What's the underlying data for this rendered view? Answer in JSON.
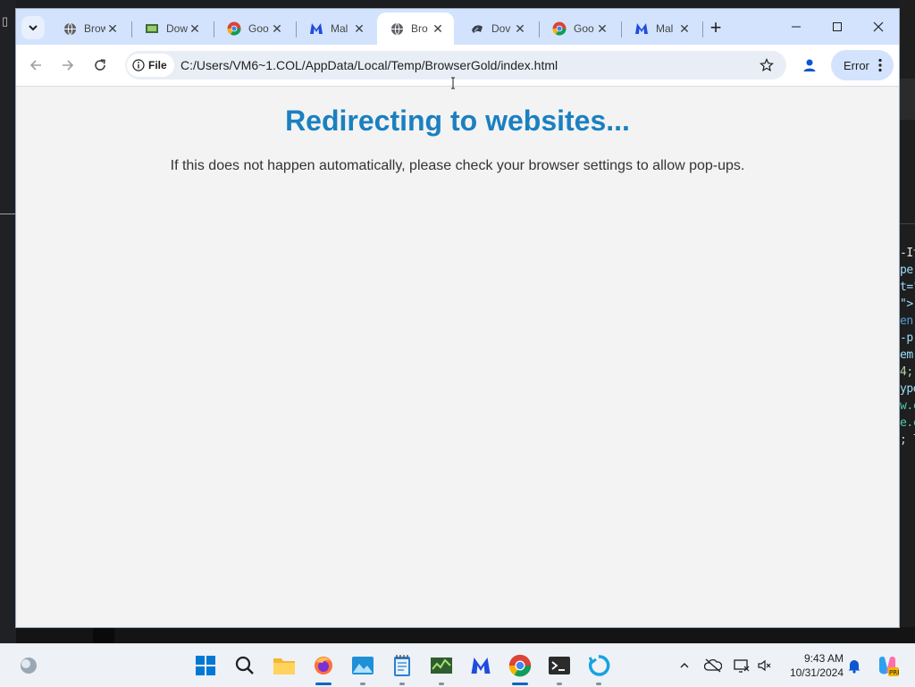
{
  "window": {
    "tabs": [
      {
        "title": "Brow",
        "favicon": "globe-icon",
        "active": false
      },
      {
        "title": "Dow",
        "favicon": "download-app-icon",
        "active": false
      },
      {
        "title": "Goo",
        "favicon": "chrome-icon",
        "active": false
      },
      {
        "title": "Mal",
        "favicon": "malwarebytes-icon",
        "active": false
      },
      {
        "title": "Bro",
        "favicon": "globe-icon",
        "active": true
      },
      {
        "title": "Dov",
        "favicon": "download-app-icon",
        "active": false
      },
      {
        "title": "Goo",
        "favicon": "chrome-icon",
        "active": false
      },
      {
        "title": "Mal",
        "favicon": "malwarebytes-icon",
        "active": false
      }
    ],
    "new_tab_label": "+",
    "controls": {
      "minimize": "—",
      "maximize": "☐",
      "close": "✕"
    }
  },
  "toolbar": {
    "site_info_label": "File",
    "url": "C:/Users/VM6~1.COL/AppData/Local/Temp/BrowserGold/index.html",
    "profile_status": "Error"
  },
  "page": {
    "heading": "Redirecting to websites...",
    "message": "If this does not happen automatically, please check your browser settings to allow pop-ups."
  },
  "taskbar": {
    "apps": [
      "start-icon",
      "search-icon",
      "file-explorer-icon",
      "firefox-icon",
      "photos-icon",
      "notepad-icon",
      "task-manager-icon",
      "malwarebytes-icon",
      "chrome-icon",
      "terminal-icon",
      "app-loop-icon"
    ],
    "time": "9:43 AM",
    "date": "10/31/2024"
  },
  "colors": {
    "heading": "#1a80c0",
    "tabstrip": "#d3e3fd",
    "page_bg": "#f3f3f3"
  }
}
